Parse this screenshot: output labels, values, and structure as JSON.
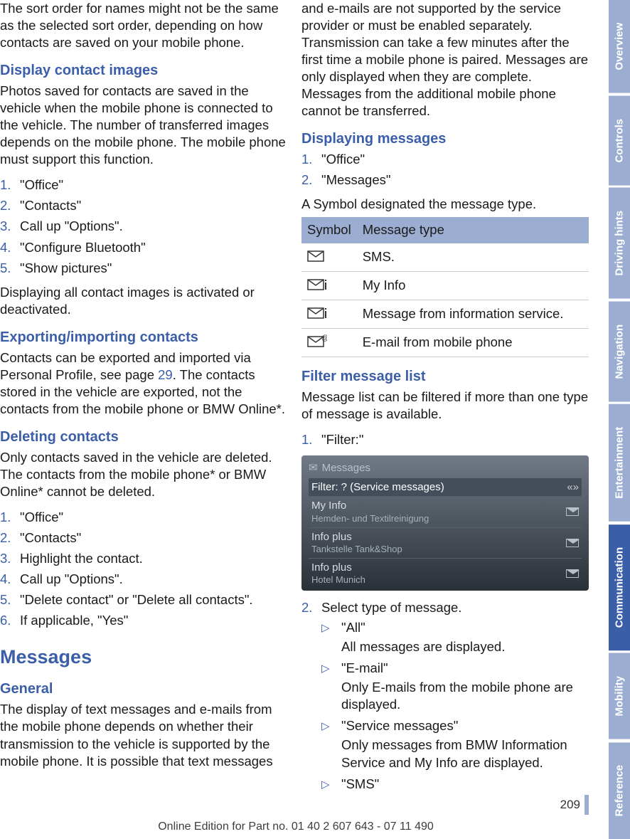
{
  "sidebar": {
    "tabs": [
      "Overview",
      "Controls",
      "Driving hints",
      "Navigation",
      "Entertainment",
      "Communication",
      "Mobility",
      "Reference"
    ],
    "active_index": 5
  },
  "page_number": "209",
  "footer": "Online Edition for Part no. 01 40 2 607 643 - 07 11 490",
  "left": {
    "intro": "The sort order for names might not be the same as the selected sort order, depending on how contacts are saved on your mobile phone.",
    "display_images": {
      "heading": "Display contact images",
      "body": "Photos saved for contacts are saved in the vehicle when the mobile phone is connected to the vehicle. The number of transferred images depends on the mobile phone. The mobile phone must support this function.",
      "steps": [
        "\"Office\"",
        "\"Contacts\"",
        "Call up \"Options\".",
        "\"Configure Bluetooth\"",
        "\"Show pictures\""
      ],
      "after": "Displaying all contact images is activated or deactivated."
    },
    "export": {
      "heading": "Exporting/importing contacts",
      "body_a": "Contacts can be exported and imported via Personal Profile, see page ",
      "page_ref": "29",
      "body_b": ". The contacts stored in the vehicle are exported, not the contacts from the mobile phone or BMW Online*."
    },
    "delete": {
      "heading": "Deleting contacts",
      "body": "Only contacts saved in the vehicle are deleted. The contacts from the mobile phone* or BMW Online* cannot be deleted.",
      "steps": [
        "\"Office\"",
        "\"Contacts\"",
        "Highlight the contact.",
        "Call up \"Options\".",
        "\"Delete contact\" or \"Delete all contacts\".",
        "If applicable, \"Yes\""
      ]
    },
    "messages": {
      "title": "Messages",
      "general_h": "General",
      "general_body": "The display of text messages and e-mails from the mobile phone depends on whether their transmission to the vehicle is supported by the mobile phone. It is possible that text messages"
    }
  },
  "right": {
    "cont": "and e-mails are not supported by the service provider or must be enabled separately. Transmission can take a few minutes after the first time a mobile phone is paired. Messages are only displayed when they are complete. Messages from the additional mobile phone cannot be transferred.",
    "displaying": {
      "heading": "Displaying messages",
      "steps": [
        "\"Office\"",
        "\"Messages\""
      ],
      "after": "A Symbol designated the message type.",
      "table": {
        "head": [
          "Symbol",
          "Message type"
        ],
        "rows": [
          {
            "icon": "sms",
            "text": "SMS."
          },
          {
            "icon": "myinfo",
            "text": "My Info"
          },
          {
            "icon": "infoservice",
            "text": "Message from information service."
          },
          {
            "icon": "email",
            "text": "E-mail from mobile phone"
          }
        ]
      }
    },
    "filter": {
      "heading": "Filter message list",
      "body": "Message list can be filtered if more than one type of message is available.",
      "step1": "\"Filter:\"",
      "screenshot": {
        "title": "Messages",
        "rows": [
          {
            "main": "Filter: ? (Service messages)",
            "hl": true
          },
          {
            "main": "My Info",
            "sub": "Hemden- und Textilreinigung"
          },
          {
            "main": "Info plus",
            "sub": "Tankstelle Tank&Shop"
          },
          {
            "main": "Info plus",
            "sub": "Hotel Munich"
          }
        ]
      },
      "step2_intro": "Select type of message.",
      "options": [
        {
          "label": "\"All\"",
          "desc": "All messages are displayed."
        },
        {
          "label": "\"E-mail\"",
          "desc": "Only E-mails from the mobile phone are displayed."
        },
        {
          "label": "\"Service messages\"",
          "desc": "Only messages from BMW Information Service and My Info are displayed."
        },
        {
          "label": "\"SMS\"",
          "desc": ""
        }
      ]
    }
  }
}
